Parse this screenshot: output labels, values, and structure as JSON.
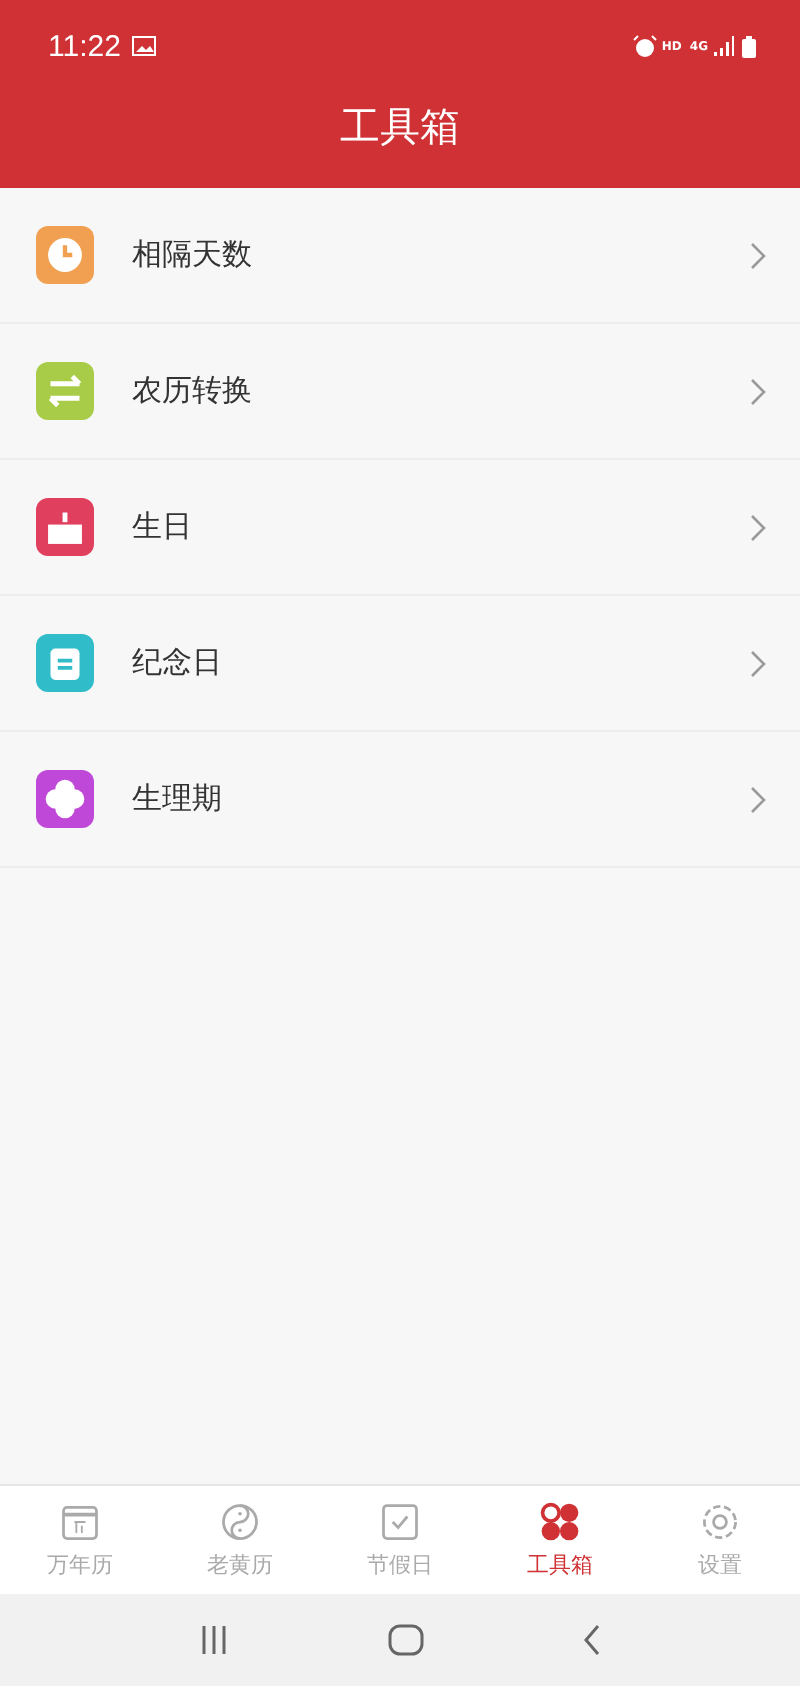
{
  "status_bar": {
    "time": "11:22",
    "network_labels": [
      "HD",
      "4G"
    ]
  },
  "header": {
    "title": "工具箱"
  },
  "tools": [
    {
      "label": "相隔天数",
      "kind": "clock",
      "color": "#f0a050"
    },
    {
      "label": "农历转换",
      "kind": "swap",
      "color": "#a8cc48"
    },
    {
      "label": "生日",
      "kind": "cake",
      "color": "#e0405e"
    },
    {
      "label": "纪念日",
      "kind": "note",
      "color": "#30bcc8"
    },
    {
      "label": "生理期",
      "kind": "flower",
      "color": "#c048d8"
    }
  ],
  "bottom_nav": [
    {
      "label": "万年历",
      "kind": "calendar",
      "selected": false
    },
    {
      "label": "老黄历",
      "kind": "yinyang",
      "selected": false
    },
    {
      "label": "节假日",
      "kind": "check",
      "selected": false
    },
    {
      "label": "工具箱",
      "kind": "dots",
      "selected": true
    },
    {
      "label": "设置",
      "kind": "gear",
      "selected": false
    }
  ]
}
